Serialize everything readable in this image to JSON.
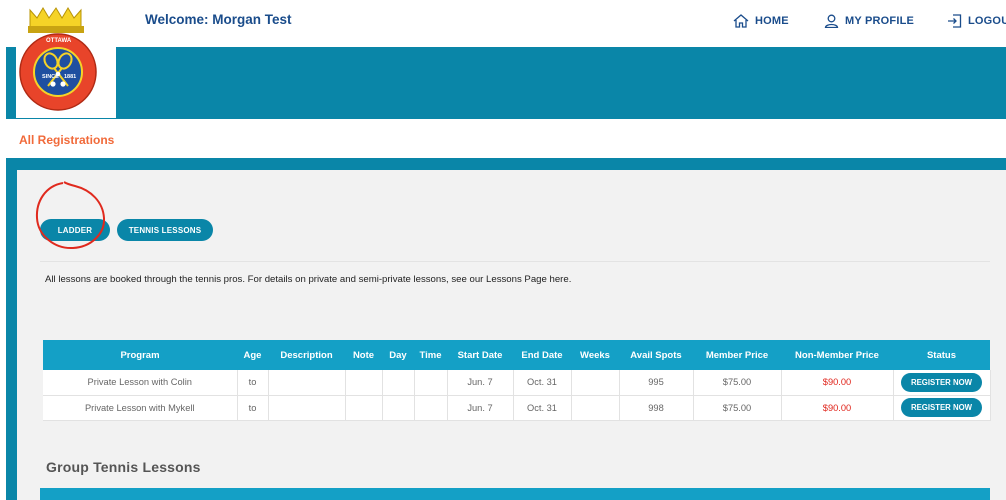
{
  "header": {
    "welcome": "Welcome: Morgan Test",
    "nav": {
      "home": "HOME",
      "profile": "MY PROFILE",
      "logout": "LOGOU"
    }
  },
  "logo": {
    "top_text": "OTTAWA",
    "since": "SINCE",
    "year": "1881",
    "ring_text": "TENNIS AND LAWN BOWLING CLUB"
  },
  "section_title": "All Registrations",
  "tabs": {
    "ladder": "LADDER",
    "tennis_lessons": "TENNIS LESSONS"
  },
  "note": "All lessons are booked through the tennis pros. For details on private and semi-private lessons, see our Lessons Page here.",
  "table": {
    "headers": {
      "program": "Program",
      "age": "Age",
      "description": "Description",
      "note": "Note",
      "day": "Day",
      "time": "Time",
      "start": "Start Date",
      "end": "End Date",
      "weeks": "Weeks",
      "avail": "Avail Spots",
      "member": "Member Price",
      "nonmember": "Non-Member Price",
      "status": "Status"
    },
    "rows": [
      {
        "program": "Private Lesson with Colin",
        "age": "to",
        "description": "",
        "note": "",
        "day": "",
        "time": "",
        "start": "Jun. 7",
        "end": "Oct. 31",
        "weeks": "",
        "avail": "995",
        "member": "$75.00",
        "nonmember": "$90.00",
        "status": "REGISTER NOW"
      },
      {
        "program": "Private Lesson with Mykell",
        "age": "to",
        "description": "",
        "note": "",
        "day": "",
        "time": "",
        "start": "Jun. 7",
        "end": "Oct. 31",
        "weeks": "",
        "avail": "998",
        "member": "$75.00",
        "nonmember": "$90.00",
        "status": "REGISTER NOW"
      }
    ]
  },
  "group_title": "Group Tennis Lessons",
  "colors": {
    "brand_teal": "#0a86a8",
    "header_teal": "#14a0c6",
    "accent_orange": "#f16a3a",
    "price_red": "#e0241b",
    "navy": "#1a4c8b",
    "annotation_red": "#e02a1e"
  }
}
